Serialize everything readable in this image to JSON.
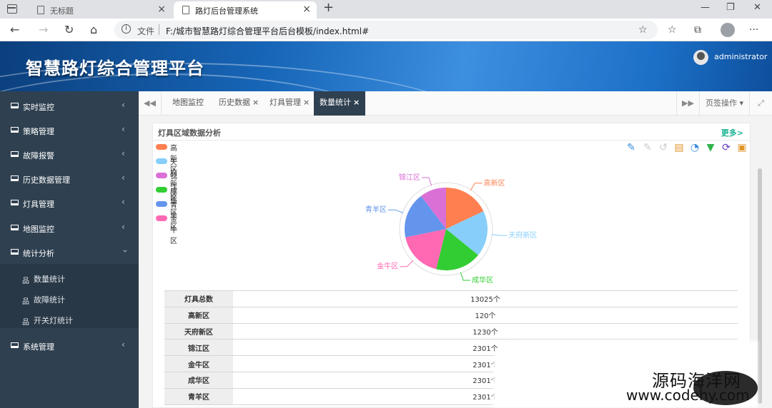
{
  "browser": {
    "tabs": [
      {
        "title": "无标题"
      },
      {
        "title": "路灯后台管理系统"
      }
    ],
    "address": {
      "scheme_label": "文件",
      "url": "F:/城市智慧路灯综合管理平台后台模板/index.html#"
    }
  },
  "header": {
    "title": "智慧路灯综合管理平台",
    "user": "administrator"
  },
  "sidebar": {
    "items": [
      {
        "label": "实时监控"
      },
      {
        "label": "策略管理"
      },
      {
        "label": "故障报警"
      },
      {
        "label": "历史数据管理"
      },
      {
        "label": "灯具管理"
      },
      {
        "label": "地图监控"
      },
      {
        "label": "统计分析"
      },
      {
        "label": "系统管理"
      }
    ],
    "subitems": [
      {
        "label": "数量统计"
      },
      {
        "label": "故障统计"
      },
      {
        "label": "开关灯统计"
      }
    ]
  },
  "pagetabs": {
    "tabs": [
      {
        "label": "地图监控"
      },
      {
        "label": "历史数据"
      },
      {
        "label": "灯具管理"
      },
      {
        "label": "数量统计"
      }
    ],
    "ops_label": "页签操作"
  },
  "panel": {
    "title": "灯具区域数据分析",
    "more": "更多>"
  },
  "chart_data": {
    "type": "pie",
    "title": "",
    "legend_position": "top-left",
    "slices": [
      {
        "name": "高新区",
        "value": 2301,
        "color": "#ff7f50"
      },
      {
        "name": "天府新区",
        "value": 2301,
        "color": "#87cefa"
      },
      {
        "name": "成华区",
        "value": 2301,
        "color": "#32cd32"
      },
      {
        "name": "金牛区",
        "value": 2301,
        "color": "#ff69b4"
      },
      {
        "name": "青羊区",
        "value": 2301,
        "color": "#6495ed"
      },
      {
        "name": "锦江区",
        "value": 1320,
        "color": "#da70d6"
      }
    ],
    "legend": [
      "高新区",
      "天府新区",
      "锦江区",
      "成华区",
      "青羊区",
      "金牛区"
    ]
  },
  "stats": {
    "rows": [
      {
        "k": "灯具总数",
        "v": "13025个"
      },
      {
        "k": "高新区",
        "v": "120个"
      },
      {
        "k": "天府新区",
        "v": "1230个"
      },
      {
        "k": "锦江区",
        "v": "2301个"
      },
      {
        "k": "金牛区",
        "v": "2301个"
      },
      {
        "k": "成华区",
        "v": "2301个"
      },
      {
        "k": "青羊区",
        "v": "2301个"
      }
    ]
  },
  "watermark": {
    "line1": "源码海洋网",
    "line2": "www.codehy.com"
  }
}
